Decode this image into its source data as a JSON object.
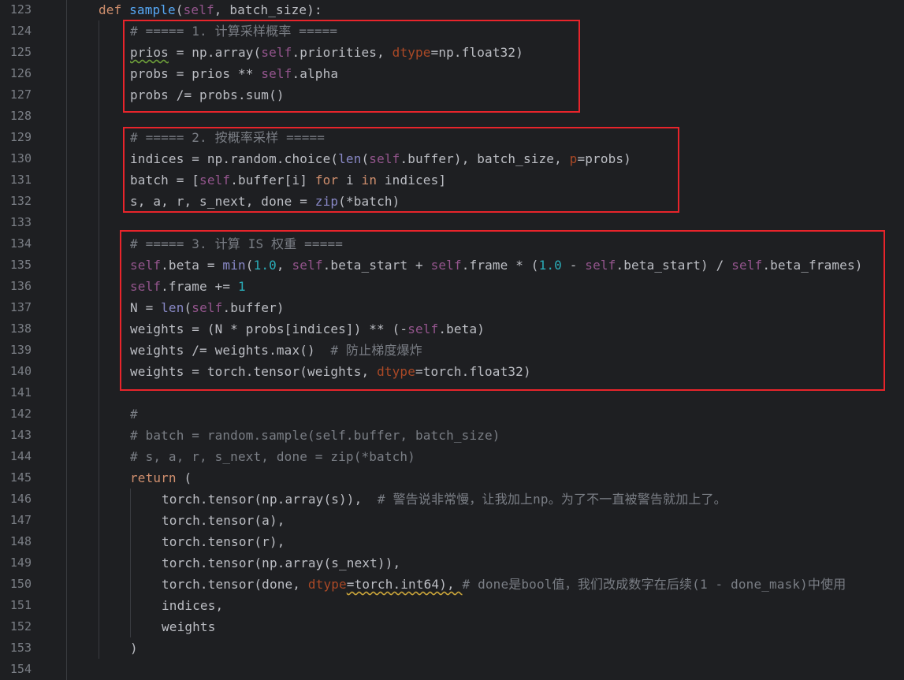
{
  "theme": {
    "background": "#1e1f22",
    "colors": {
      "default": "#bcbec4",
      "keyword": "#cf8e6d",
      "function": "#56a8f5",
      "self": "#94558d",
      "number": "#2aacb8",
      "comment": "#7a7e85",
      "param": "#aa4926",
      "builtin": "#8888c6",
      "dunder": "#b200b2",
      "highlight_box": "#e8242b"
    }
  },
  "editor": {
    "first_line_number": 123,
    "lines": [
      {
        "num": "123",
        "indent": 0,
        "tokens": [
          [
            "def ",
            "keyword"
          ],
          [
            "sample",
            "function"
          ],
          [
            "(",
            "default"
          ],
          [
            "self",
            "self"
          ],
          [
            ", batch_size):",
            "default"
          ]
        ]
      },
      {
        "num": "124",
        "indent": 2,
        "tokens": [
          [
            "# ===== 1. 计算采样概率 =====",
            "comment"
          ]
        ]
      },
      {
        "num": "125",
        "indent": 2,
        "tokens": [
          [
            "prios",
            "default"
          ],
          [
            " = np.array(",
            "default"
          ],
          [
            "self",
            "self"
          ],
          [
            ".priorities, ",
            "default"
          ],
          [
            "dtype",
            "param"
          ],
          [
            "=np.float32)",
            "default"
          ]
        ]
      },
      {
        "num": "126",
        "indent": 2,
        "tokens": [
          [
            "probs = prios ** ",
            "default"
          ],
          [
            "self",
            "self"
          ],
          [
            ".alpha",
            "default"
          ]
        ]
      },
      {
        "num": "127",
        "indent": 2,
        "tokens": [
          [
            "probs /= probs.sum()",
            "default"
          ]
        ]
      },
      {
        "num": "128",
        "indent": 2,
        "tokens": []
      },
      {
        "num": "129",
        "indent": 2,
        "tokens": [
          [
            "# ===== 2. 按概率采样 =====",
            "comment"
          ]
        ]
      },
      {
        "num": "130",
        "indent": 2,
        "tokens": [
          [
            "indices = np.random.choice(",
            "default"
          ],
          [
            "len",
            "builtin"
          ],
          [
            "(",
            "default"
          ],
          [
            "self",
            "self"
          ],
          [
            ".buffer), batch_size, ",
            "default"
          ],
          [
            "p",
            "param"
          ],
          [
            "=probs)",
            "default"
          ]
        ]
      },
      {
        "num": "131",
        "indent": 2,
        "tokens": [
          [
            "batch = [",
            "default"
          ],
          [
            "self",
            "self"
          ],
          [
            ".buffer[i] ",
            "default"
          ],
          [
            "for",
            "keyword"
          ],
          [
            " i ",
            "default"
          ],
          [
            "in",
            "keyword"
          ],
          [
            " indices]",
            "default"
          ]
        ]
      },
      {
        "num": "132",
        "indent": 2,
        "tokens": [
          [
            "s, a, r, s_next, done = ",
            "default"
          ],
          [
            "zip",
            "builtin"
          ],
          [
            "(*batch)",
            "default"
          ]
        ]
      },
      {
        "num": "133",
        "indent": 2,
        "tokens": []
      },
      {
        "num": "134",
        "indent": 2,
        "tokens": [
          [
            "# ===== 3. 计算 IS 权重 =====",
            "comment"
          ]
        ]
      },
      {
        "num": "135",
        "indent": 2,
        "tokens": [
          [
            "self",
            "self"
          ],
          [
            ".beta = ",
            "default"
          ],
          [
            "min",
            "builtin"
          ],
          [
            "(",
            "default"
          ],
          [
            "1.0",
            "number"
          ],
          [
            ", ",
            "default"
          ],
          [
            "self",
            "self"
          ],
          [
            ".beta_start + ",
            "default"
          ],
          [
            "self",
            "self"
          ],
          [
            ".frame * (",
            "default"
          ],
          [
            "1.0",
            "number"
          ],
          [
            " - ",
            "default"
          ],
          [
            "self",
            "self"
          ],
          [
            ".beta_start) / ",
            "default"
          ],
          [
            "self",
            "self"
          ],
          [
            ".beta_frames)",
            "default"
          ]
        ]
      },
      {
        "num": "136",
        "indent": 2,
        "tokens": [
          [
            "self",
            "self"
          ],
          [
            ".frame += ",
            "default"
          ],
          [
            "1",
            "number"
          ]
        ]
      },
      {
        "num": "137",
        "indent": 2,
        "tokens": [
          [
            "N = ",
            "default"
          ],
          [
            "len",
            "builtin"
          ],
          [
            "(",
            "default"
          ],
          [
            "self",
            "self"
          ],
          [
            ".buffer)",
            "default"
          ]
        ]
      },
      {
        "num": "138",
        "indent": 2,
        "tokens": [
          [
            "weights = (N * probs[indices]) ** (-",
            "default"
          ],
          [
            "self",
            "self"
          ],
          [
            ".beta)",
            "default"
          ]
        ]
      },
      {
        "num": "139",
        "indent": 2,
        "tokens": [
          [
            "weights /= weights.max()  ",
            "default"
          ],
          [
            "# 防止梯度爆炸",
            "comment"
          ]
        ]
      },
      {
        "num": "140",
        "indent": 2,
        "tokens": [
          [
            "weights = torch.tensor(weights, ",
            "default"
          ],
          [
            "dtype",
            "param"
          ],
          [
            "=torch.float32)",
            "default"
          ]
        ]
      },
      {
        "num": "141",
        "indent": 2,
        "tokens": []
      },
      {
        "num": "142",
        "indent": 2,
        "tokens": [
          [
            "#",
            "comment"
          ]
        ]
      },
      {
        "num": "143",
        "indent": 2,
        "tokens": [
          [
            "# batch = random.sample(self.buffer, batch_size)",
            "comment"
          ]
        ]
      },
      {
        "num": "144",
        "indent": 2,
        "tokens": [
          [
            "# s, a, r, s_next, done = zip(*batch)",
            "comment"
          ]
        ]
      },
      {
        "num": "145",
        "indent": 2,
        "tokens": [
          [
            "return",
            "keyword"
          ],
          [
            " (",
            "default"
          ]
        ]
      },
      {
        "num": "146",
        "indent": 4,
        "tokens": [
          [
            "torch.tensor(np.array(s)),  ",
            "default"
          ],
          [
            "# 警告说非常慢，让我加上np。为了不一直被警告就加上了。",
            "comment"
          ]
        ]
      },
      {
        "num": "147",
        "indent": 4,
        "tokens": [
          [
            "torch.tensor(a),",
            "default"
          ]
        ]
      },
      {
        "num": "148",
        "indent": 4,
        "tokens": [
          [
            "torch.tensor(r),",
            "default"
          ]
        ]
      },
      {
        "num": "149",
        "indent": 4,
        "tokens": [
          [
            "torch.tensor(np.array(s_next)),",
            "default"
          ]
        ]
      },
      {
        "num": "150",
        "indent": 4,
        "tokens": [
          [
            "torch.tensor(done, ",
            "default"
          ],
          [
            "dtype",
            "param"
          ],
          [
            "=torch.int64), ",
            "default"
          ],
          [
            "# done是bool值，我们改成数字在后续(1 - done_mask)中使用",
            "comment"
          ]
        ]
      },
      {
        "num": "151",
        "indent": 4,
        "tokens": [
          [
            "indices,",
            "default"
          ]
        ]
      },
      {
        "num": "152",
        "indent": 4,
        "tokens": [
          [
            "weights",
            "default"
          ]
        ]
      },
      {
        "num": "153",
        "indent": 2,
        "tokens": [
          [
            ")",
            "default"
          ]
        ]
      },
      {
        "num": "154",
        "indent": 0,
        "tokens": []
      }
    ]
  }
}
